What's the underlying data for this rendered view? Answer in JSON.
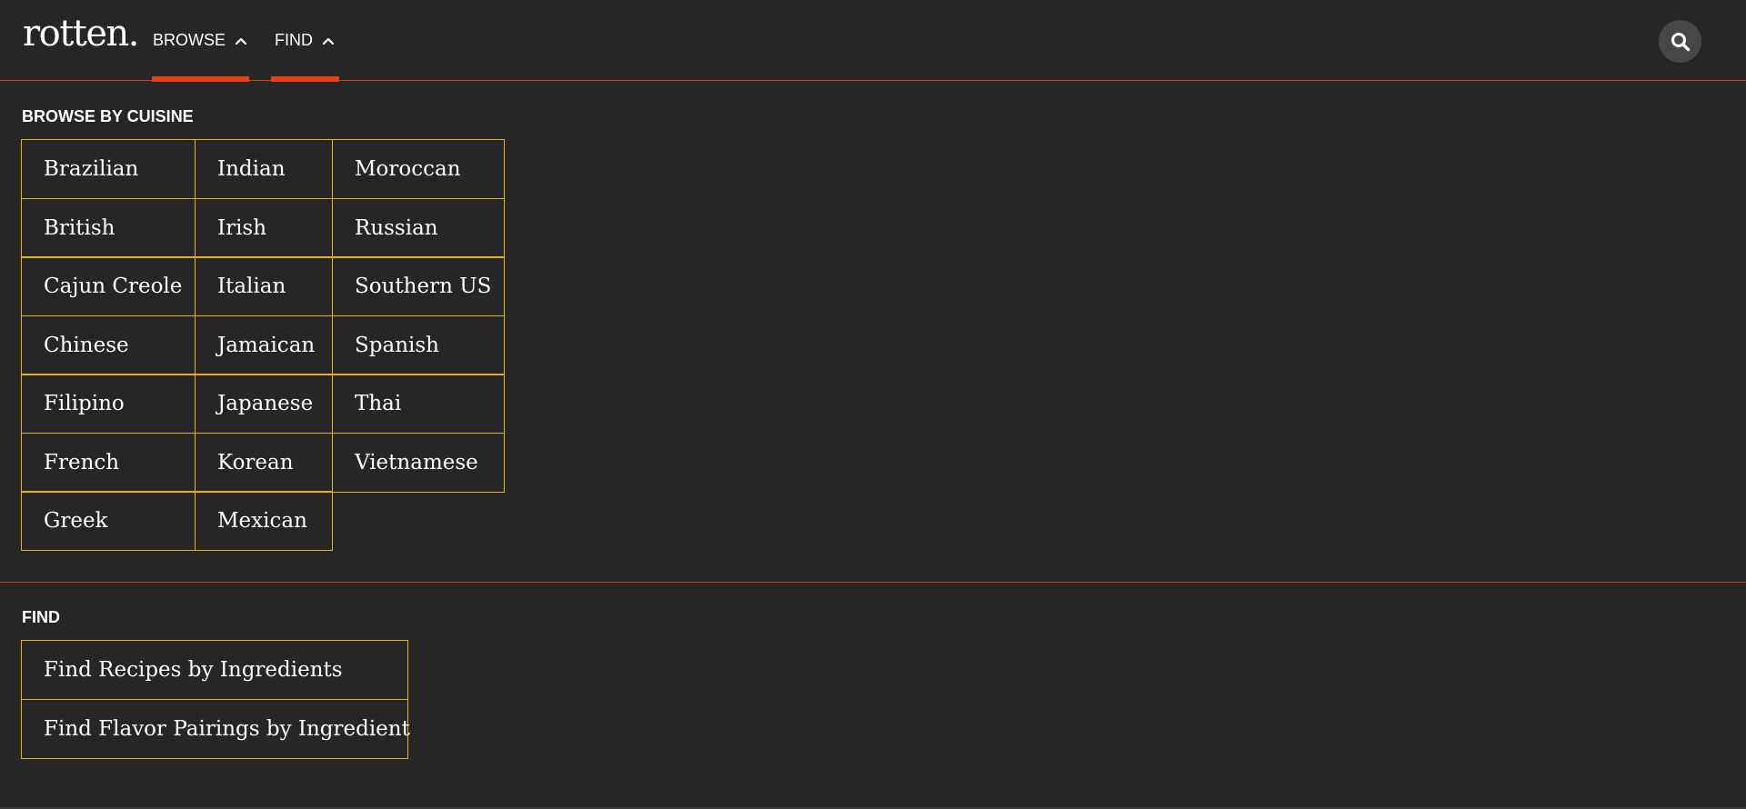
{
  "header": {
    "logo": "rotten.",
    "nav": [
      {
        "label": "BROWSE"
      },
      {
        "label": "FIND"
      }
    ],
    "search_icon": "search-icon"
  },
  "colors": {
    "accent": "#e8400f",
    "grid_border": "#e3b21d",
    "background": "#262626"
  },
  "browse": {
    "title": "BROWSE BY CUISINE",
    "columns": [
      [
        "Brazilian",
        "British",
        "Cajun Creole",
        "Chinese",
        "Filipino",
        "French",
        "Greek"
      ],
      [
        "Indian",
        "Irish",
        "Italian",
        "Jamaican",
        "Japanese",
        "Korean",
        "Mexican"
      ],
      [
        "Moroccan",
        "Russian",
        "Southern US",
        "Spanish",
        "Thai",
        "Vietnamese"
      ]
    ]
  },
  "find": {
    "title": "FIND",
    "items": [
      "Find Recipes by Ingredients",
      "Find Flavor Pairings by Ingredient"
    ]
  }
}
